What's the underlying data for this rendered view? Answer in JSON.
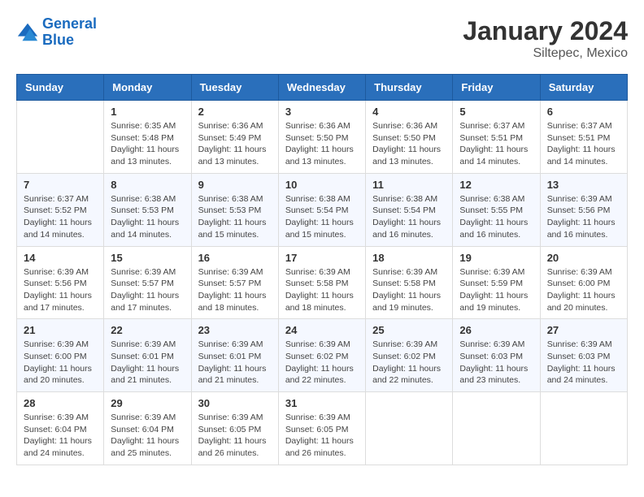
{
  "header": {
    "logo_line1": "General",
    "logo_line2": "Blue",
    "month": "January 2024",
    "location": "Siltepec, Mexico"
  },
  "days_of_week": [
    "Sunday",
    "Monday",
    "Tuesday",
    "Wednesday",
    "Thursday",
    "Friday",
    "Saturday"
  ],
  "weeks": [
    [
      {
        "day": "",
        "info": ""
      },
      {
        "day": "1",
        "info": "Sunrise: 6:35 AM\nSunset: 5:48 PM\nDaylight: 11 hours\nand 13 minutes."
      },
      {
        "day": "2",
        "info": "Sunrise: 6:36 AM\nSunset: 5:49 PM\nDaylight: 11 hours\nand 13 minutes."
      },
      {
        "day": "3",
        "info": "Sunrise: 6:36 AM\nSunset: 5:50 PM\nDaylight: 11 hours\nand 13 minutes."
      },
      {
        "day": "4",
        "info": "Sunrise: 6:36 AM\nSunset: 5:50 PM\nDaylight: 11 hours\nand 13 minutes."
      },
      {
        "day": "5",
        "info": "Sunrise: 6:37 AM\nSunset: 5:51 PM\nDaylight: 11 hours\nand 14 minutes."
      },
      {
        "day": "6",
        "info": "Sunrise: 6:37 AM\nSunset: 5:51 PM\nDaylight: 11 hours\nand 14 minutes."
      }
    ],
    [
      {
        "day": "7",
        "info": "Sunrise: 6:37 AM\nSunset: 5:52 PM\nDaylight: 11 hours\nand 14 minutes."
      },
      {
        "day": "8",
        "info": "Sunrise: 6:38 AM\nSunset: 5:53 PM\nDaylight: 11 hours\nand 14 minutes."
      },
      {
        "day": "9",
        "info": "Sunrise: 6:38 AM\nSunset: 5:53 PM\nDaylight: 11 hours\nand 15 minutes."
      },
      {
        "day": "10",
        "info": "Sunrise: 6:38 AM\nSunset: 5:54 PM\nDaylight: 11 hours\nand 15 minutes."
      },
      {
        "day": "11",
        "info": "Sunrise: 6:38 AM\nSunset: 5:54 PM\nDaylight: 11 hours\nand 16 minutes."
      },
      {
        "day": "12",
        "info": "Sunrise: 6:38 AM\nSunset: 5:55 PM\nDaylight: 11 hours\nand 16 minutes."
      },
      {
        "day": "13",
        "info": "Sunrise: 6:39 AM\nSunset: 5:56 PM\nDaylight: 11 hours\nand 16 minutes."
      }
    ],
    [
      {
        "day": "14",
        "info": "Sunrise: 6:39 AM\nSunset: 5:56 PM\nDaylight: 11 hours\nand 17 minutes."
      },
      {
        "day": "15",
        "info": "Sunrise: 6:39 AM\nSunset: 5:57 PM\nDaylight: 11 hours\nand 17 minutes."
      },
      {
        "day": "16",
        "info": "Sunrise: 6:39 AM\nSunset: 5:57 PM\nDaylight: 11 hours\nand 18 minutes."
      },
      {
        "day": "17",
        "info": "Sunrise: 6:39 AM\nSunset: 5:58 PM\nDaylight: 11 hours\nand 18 minutes."
      },
      {
        "day": "18",
        "info": "Sunrise: 6:39 AM\nSunset: 5:58 PM\nDaylight: 11 hours\nand 19 minutes."
      },
      {
        "day": "19",
        "info": "Sunrise: 6:39 AM\nSunset: 5:59 PM\nDaylight: 11 hours\nand 19 minutes."
      },
      {
        "day": "20",
        "info": "Sunrise: 6:39 AM\nSunset: 6:00 PM\nDaylight: 11 hours\nand 20 minutes."
      }
    ],
    [
      {
        "day": "21",
        "info": "Sunrise: 6:39 AM\nSunset: 6:00 PM\nDaylight: 11 hours\nand 20 minutes."
      },
      {
        "day": "22",
        "info": "Sunrise: 6:39 AM\nSunset: 6:01 PM\nDaylight: 11 hours\nand 21 minutes."
      },
      {
        "day": "23",
        "info": "Sunrise: 6:39 AM\nSunset: 6:01 PM\nDaylight: 11 hours\nand 21 minutes."
      },
      {
        "day": "24",
        "info": "Sunrise: 6:39 AM\nSunset: 6:02 PM\nDaylight: 11 hours\nand 22 minutes."
      },
      {
        "day": "25",
        "info": "Sunrise: 6:39 AM\nSunset: 6:02 PM\nDaylight: 11 hours\nand 22 minutes."
      },
      {
        "day": "26",
        "info": "Sunrise: 6:39 AM\nSunset: 6:03 PM\nDaylight: 11 hours\nand 23 minutes."
      },
      {
        "day": "27",
        "info": "Sunrise: 6:39 AM\nSunset: 6:03 PM\nDaylight: 11 hours\nand 24 minutes."
      }
    ],
    [
      {
        "day": "28",
        "info": "Sunrise: 6:39 AM\nSunset: 6:04 PM\nDaylight: 11 hours\nand 24 minutes."
      },
      {
        "day": "29",
        "info": "Sunrise: 6:39 AM\nSunset: 6:04 PM\nDaylight: 11 hours\nand 25 minutes."
      },
      {
        "day": "30",
        "info": "Sunrise: 6:39 AM\nSunset: 6:05 PM\nDaylight: 11 hours\nand 26 minutes."
      },
      {
        "day": "31",
        "info": "Sunrise: 6:39 AM\nSunset: 6:05 PM\nDaylight: 11 hours\nand 26 minutes."
      },
      {
        "day": "",
        "info": ""
      },
      {
        "day": "",
        "info": ""
      },
      {
        "day": "",
        "info": ""
      }
    ]
  ]
}
